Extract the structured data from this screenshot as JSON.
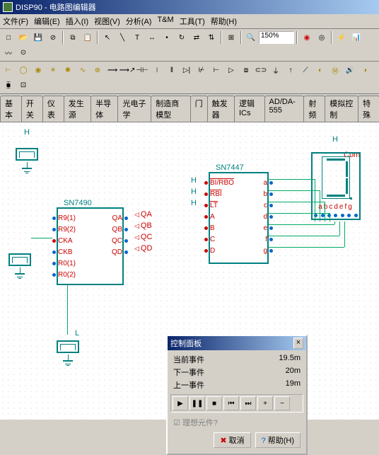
{
  "window": {
    "title": "DISP90 - 电路图编辑器"
  },
  "menu": [
    "文件(F)",
    "编辑(E)",
    "插入(I)",
    "视图(V)",
    "分析(A)",
    "T&M",
    "工具(T)",
    "帮助(H)"
  ],
  "zoom": "150%",
  "tabs": [
    "基本",
    "开关",
    "仪表",
    "发生源",
    "半导体",
    "光电子学",
    "制造商模型",
    "门",
    "触发器",
    "逻辑ICs",
    "AD/DA-555",
    "射频",
    "模拟控制",
    "特殊"
  ],
  "sn7490": {
    "name": "SN7490",
    "left": [
      "R9(1)",
      "R9(2)",
      "CKA",
      "CKB",
      "R0(1)",
      "R0(2)"
    ],
    "right": [
      "QA",
      "QB",
      "QC",
      "QD"
    ]
  },
  "sn7447": {
    "name": "SN7447",
    "left": [
      "BI/RBO",
      "RBI",
      "LT",
      "A",
      "B",
      "C",
      "D"
    ],
    "right": [
      "a",
      "b",
      "c",
      "d",
      "e",
      "f",
      "g"
    ]
  },
  "qbus": [
    "QA",
    "QB",
    "QC",
    "QD"
  ],
  "seg7": {
    "com": "Com",
    "labels": "abcdefg"
  },
  "nodes": {
    "H1": "H",
    "H2": "H",
    "H3": "H",
    "H4": "H",
    "L": "L"
  },
  "dialog": {
    "title": "控制面板",
    "rows": [
      {
        "label": "当前事件",
        "value": "19.5m"
      },
      {
        "label": "下一事件",
        "value": "20m"
      },
      {
        "label": "上一事件",
        "value": "19m"
      }
    ],
    "check": "理想元件?",
    "cancel": "取消",
    "help": "帮助(H)"
  }
}
